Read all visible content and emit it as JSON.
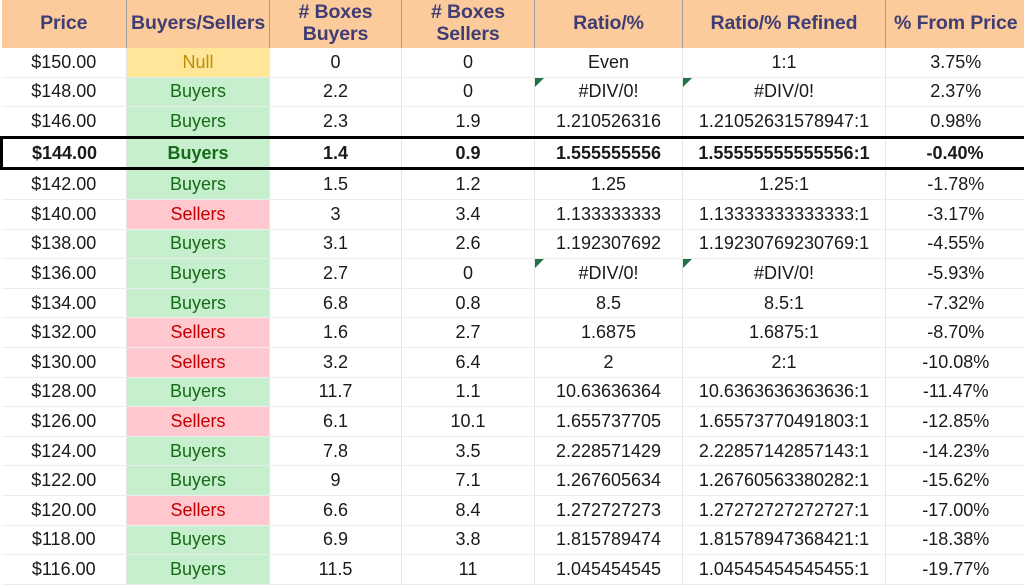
{
  "table": {
    "columns": [
      {
        "key": "price",
        "label": "Price"
      },
      {
        "key": "bs",
        "label": "Buyers/Sellers"
      },
      {
        "key": "bb",
        "label": "# Boxes\nBuyers",
        "line1": "# Boxes",
        "line2": "Buyers"
      },
      {
        "key": "bsel",
        "label": "# Boxes\nSellers",
        "line1": "# Boxes",
        "line2": "Sellers"
      },
      {
        "key": "ratio",
        "label": "Ratio/%"
      },
      {
        "key": "refined",
        "label": "Ratio/% Refined"
      },
      {
        "key": "pct",
        "label": "% From Price"
      }
    ],
    "colors": {
      "header_bg": "#FBCB9B",
      "header_text": "#3F3D74",
      "null_bg": "#FFE699",
      "null_text": "#BF8F00",
      "buyers_bg": "#C6EFCE",
      "buyers_text": "#156B16",
      "sellers_bg": "#FFC7CE",
      "sellers_text": "#C00000",
      "comment_flag": "#217346",
      "focus_border": "#000000"
    },
    "rows": [
      {
        "price": "$150.00",
        "bs": "Null",
        "sentiment": "null",
        "bb": "0",
        "bsel": "0",
        "ratio": "Even",
        "refined": "1:1",
        "pct": "3.75%",
        "comment": false,
        "focus": false
      },
      {
        "price": "$148.00",
        "bs": "Buyers",
        "sentiment": "buyers",
        "bb": "2.2",
        "bsel": "0",
        "ratio": "#DIV/0!",
        "refined": "#DIV/0!",
        "pct": "2.37%",
        "comment": true,
        "focus": false
      },
      {
        "price": "$146.00",
        "bs": "Buyers",
        "sentiment": "buyers",
        "bb": "2.3",
        "bsel": "1.9",
        "ratio": "1.210526316",
        "refined": "1.21052631578947:1",
        "pct": "0.98%",
        "comment": false,
        "focus": false
      },
      {
        "price": "$144.00",
        "bs": "Buyers",
        "sentiment": "buyers",
        "bb": "1.4",
        "bsel": "0.9",
        "ratio": "1.555555556",
        "refined": "1.55555555555556:1",
        "pct": "-0.40%",
        "comment": false,
        "focus": true
      },
      {
        "price": "$142.00",
        "bs": "Buyers",
        "sentiment": "buyers",
        "bb": "1.5",
        "bsel": "1.2",
        "ratio": "1.25",
        "refined": "1.25:1",
        "pct": "-1.78%",
        "comment": false,
        "focus": false
      },
      {
        "price": "$140.00",
        "bs": "Sellers",
        "sentiment": "sellers",
        "bb": "3",
        "bsel": "3.4",
        "ratio": "1.133333333",
        "refined": "1.13333333333333:1",
        "pct": "-3.17%",
        "comment": false,
        "focus": false
      },
      {
        "price": "$138.00",
        "bs": "Buyers",
        "sentiment": "buyers",
        "bb": "3.1",
        "bsel": "2.6",
        "ratio": "1.192307692",
        "refined": "1.19230769230769:1",
        "pct": "-4.55%",
        "comment": false,
        "focus": false
      },
      {
        "price": "$136.00",
        "bs": "Buyers",
        "sentiment": "buyers",
        "bb": "2.7",
        "bsel": "0",
        "ratio": "#DIV/0!",
        "refined": "#DIV/0!",
        "pct": "-5.93%",
        "comment": true,
        "focus": false
      },
      {
        "price": "$134.00",
        "bs": "Buyers",
        "sentiment": "buyers",
        "bb": "6.8",
        "bsel": "0.8",
        "ratio": "8.5",
        "refined": "8.5:1",
        "pct": "-7.32%",
        "comment": false,
        "focus": false
      },
      {
        "price": "$132.00",
        "bs": "Sellers",
        "sentiment": "sellers",
        "bb": "1.6",
        "bsel": "2.7",
        "ratio": "1.6875",
        "refined": "1.6875:1",
        "pct": "-8.70%",
        "comment": false,
        "focus": false
      },
      {
        "price": "$130.00",
        "bs": "Sellers",
        "sentiment": "sellers",
        "bb": "3.2",
        "bsel": "6.4",
        "ratio": "2",
        "refined": "2:1",
        "pct": "-10.08%",
        "comment": false,
        "focus": false
      },
      {
        "price": "$128.00",
        "bs": "Buyers",
        "sentiment": "buyers",
        "bb": "11.7",
        "bsel": "1.1",
        "ratio": "10.63636364",
        "refined": "10.6363636363636:1",
        "pct": "-11.47%",
        "comment": false,
        "focus": false
      },
      {
        "price": "$126.00",
        "bs": "Sellers",
        "sentiment": "sellers",
        "bb": "6.1",
        "bsel": "10.1",
        "ratio": "1.655737705",
        "refined": "1.65573770491803:1",
        "pct": "-12.85%",
        "comment": false,
        "focus": false
      },
      {
        "price": "$124.00",
        "bs": "Buyers",
        "sentiment": "buyers",
        "bb": "7.8",
        "bsel": "3.5",
        "ratio": "2.228571429",
        "refined": "2.22857142857143:1",
        "pct": "-14.23%",
        "comment": false,
        "focus": false
      },
      {
        "price": "$122.00",
        "bs": "Buyers",
        "sentiment": "buyers",
        "bb": "9",
        "bsel": "7.1",
        "ratio": "1.267605634",
        "refined": "1.26760563380282:1",
        "pct": "-15.62%",
        "comment": false,
        "focus": false
      },
      {
        "price": "$120.00",
        "bs": "Sellers",
        "sentiment": "sellers",
        "bb": "6.6",
        "bsel": "8.4",
        "ratio": "1.272727273",
        "refined": "1.27272727272727:1",
        "pct": "-17.00%",
        "comment": false,
        "focus": false
      },
      {
        "price": "$118.00",
        "bs": "Buyers",
        "sentiment": "buyers",
        "bb": "6.9",
        "bsel": "3.8",
        "ratio": "1.815789474",
        "refined": "1.81578947368421:1",
        "pct": "-18.38%",
        "comment": false,
        "focus": false
      },
      {
        "price": "$116.00",
        "bs": "Buyers",
        "sentiment": "buyers",
        "bb": "11.5",
        "bsel": "11",
        "ratio": "1.045454545",
        "refined": "1.04545454545455:1",
        "pct": "-19.77%",
        "comment": false,
        "focus": false
      }
    ]
  }
}
